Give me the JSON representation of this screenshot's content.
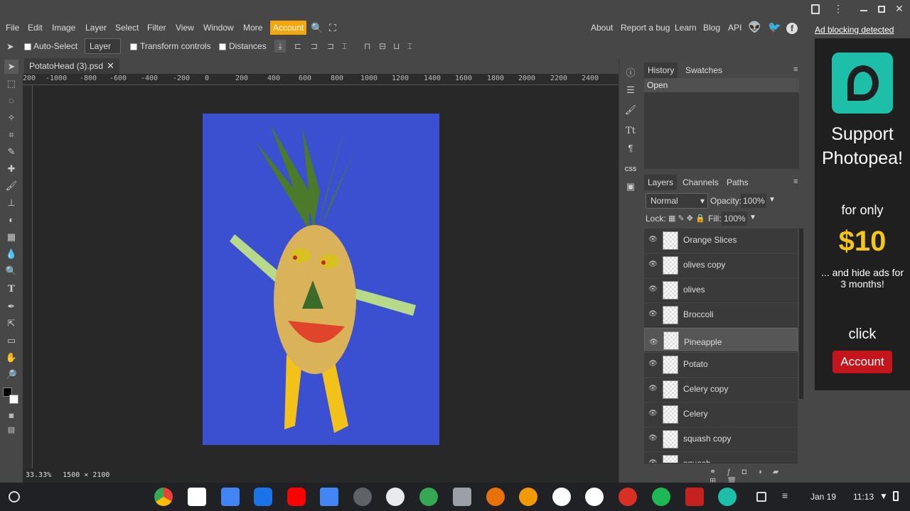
{
  "menu": {
    "items": [
      "File",
      "Edit",
      "Image",
      "Layer",
      "Select",
      "Filter",
      "View",
      "Window",
      "More"
    ],
    "account": "Account",
    "right": [
      "About",
      "Report a bug",
      "Learn",
      "Blog",
      "API"
    ]
  },
  "options": {
    "auto_select": "Auto-Select",
    "layer_select": "Layer",
    "transform_controls": "Transform controls",
    "distances": "Distances"
  },
  "document": {
    "tab": "PotatoHead (3).psd",
    "zoom": "33.33%",
    "size": "1500 × 2100",
    "ruler_labels": [
      "200",
      "-1000",
      "-800",
      "-600",
      "-400",
      "-200",
      "0",
      "200",
      "400",
      "600",
      "800",
      "1000",
      "1200",
      "1400",
      "1600",
      "1800",
      "2000",
      "2200",
      "2400"
    ]
  },
  "history": {
    "tabs": [
      "History",
      "Swatches"
    ],
    "entries": [
      "Open"
    ]
  },
  "layers": {
    "tabs": [
      "Layers",
      "Channels",
      "Paths"
    ],
    "blend_mode": "Normal",
    "opacity_label": "Opacity:",
    "opacity": "100%",
    "lock_label": "Lock:",
    "fill_label": "Fill:",
    "fill": "100%",
    "items": [
      {
        "name": "Orange Slices",
        "selected": false
      },
      {
        "name": "olives copy",
        "selected": false
      },
      {
        "name": "olives",
        "selected": false
      },
      {
        "name": "Broccoli",
        "selected": false
      },
      {
        "name": "Pineapple",
        "selected": true
      },
      {
        "name": "Potato",
        "selected": false
      },
      {
        "name": "Celery copy",
        "selected": false
      },
      {
        "name": "Celery",
        "selected": false
      },
      {
        "name": "squash copy",
        "selected": false
      },
      {
        "name": "squash",
        "selected": false
      }
    ]
  },
  "ad": {
    "blocking": "Ad blocking detected",
    "headline": "Support Photopea!",
    "for_only": "for only",
    "price": "$10",
    "sub": "... and hide ads for 3 months!",
    "click": "click",
    "button": "Account"
  },
  "taskbar": {
    "date": "Jan 19",
    "time": "11:13"
  },
  "colors": {
    "accent": "#f4a70a",
    "canvas": "#3b4fd1",
    "ad_teal": "#1dbfa8",
    "ad_price": "#f5c518",
    "ad_button": "#c4151c"
  }
}
